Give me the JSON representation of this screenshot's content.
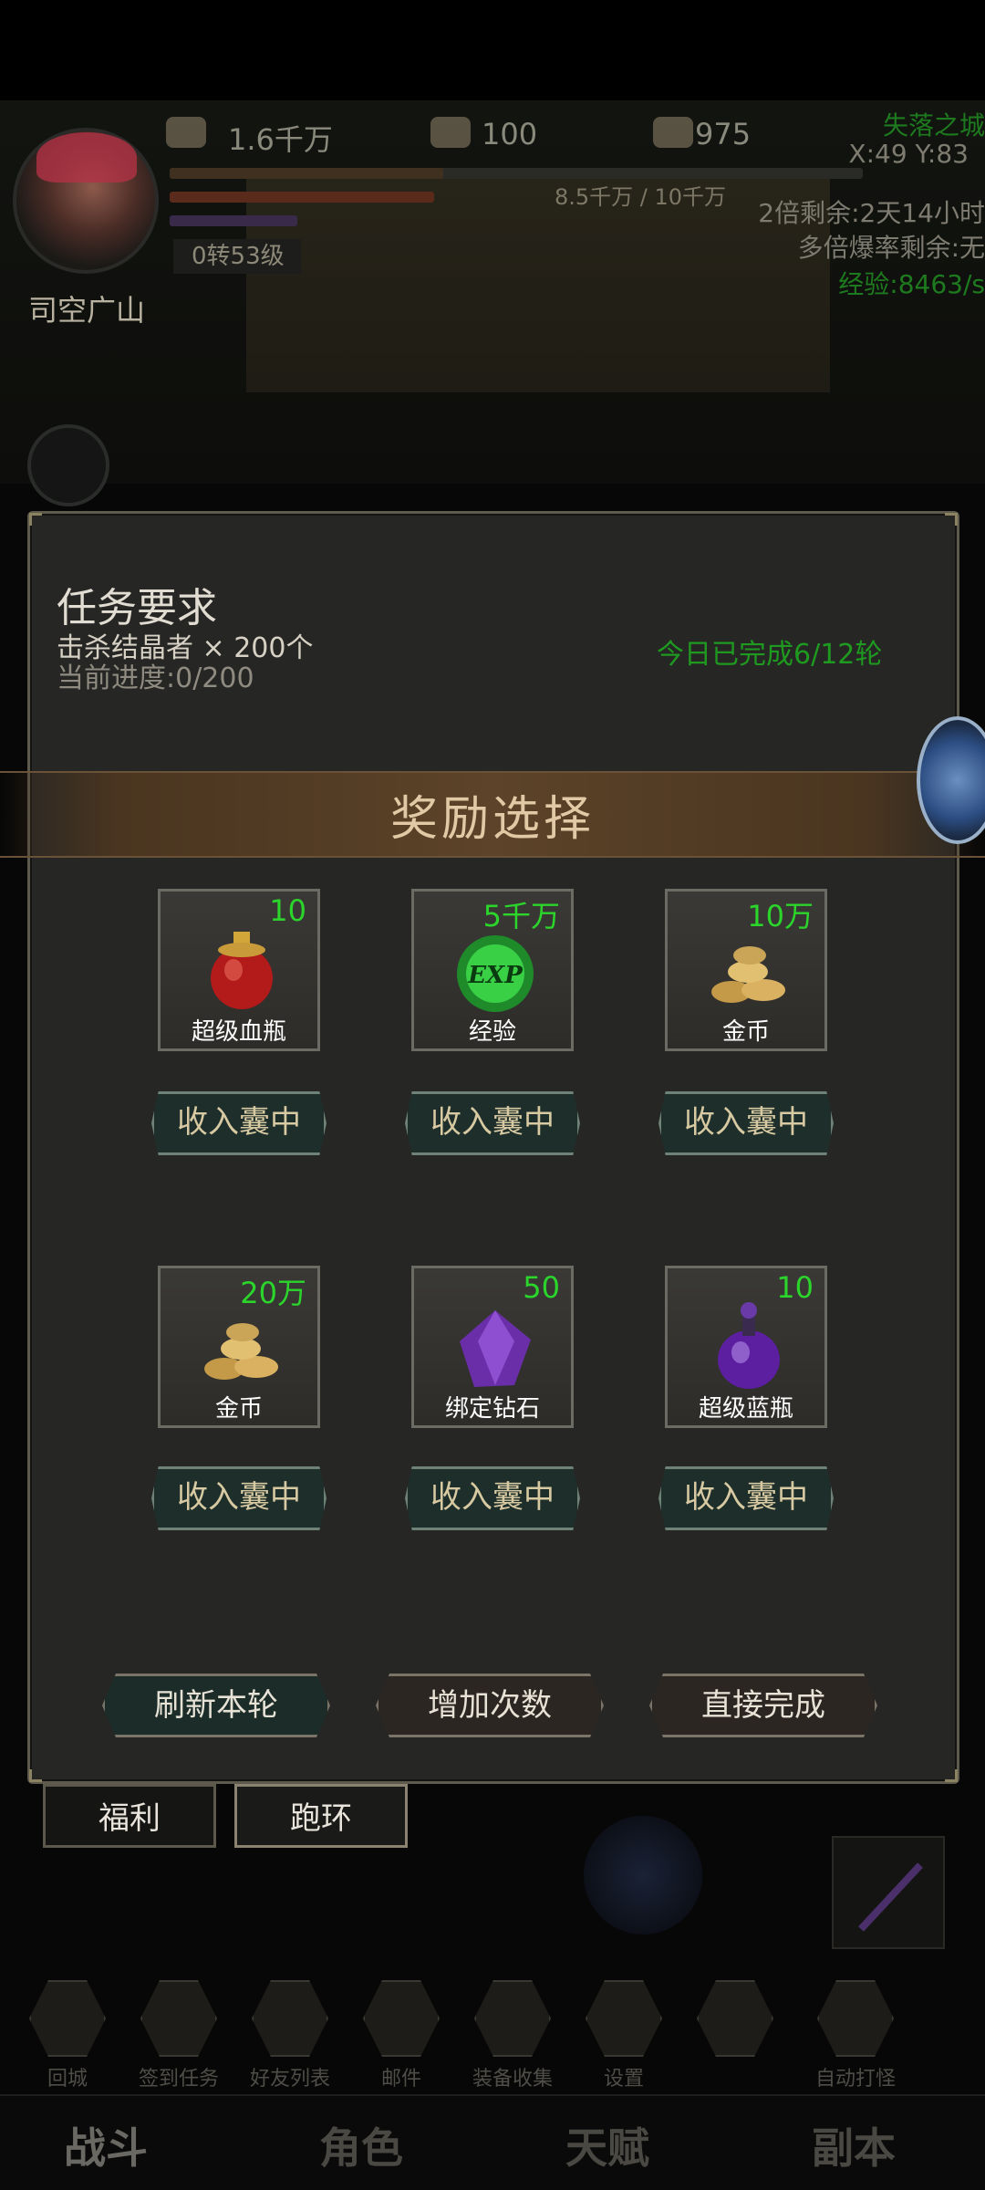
{
  "hud": {
    "player_name": "司空广山",
    "gold": "1.6千万",
    "ingot": "100",
    "chest": "975",
    "level": "0转53级",
    "hp": "8.5千万 / 10千万",
    "map_name": "失落之城",
    "coords": "X:49 Y:83",
    "double_remaining": "2倍剩余:2天14小时",
    "multi_drop": "多倍爆率剩余:无",
    "exp_rate": "经验:8463/s"
  },
  "task": {
    "title": "任务要求",
    "requirement": "击杀结晶者 × 200个",
    "progress": "当前进度:0/200",
    "today": "今日已完成6/12轮"
  },
  "reward": {
    "heading": "奖励选择",
    "store_label": "收入囊中",
    "items": [
      {
        "name": "超级血瓶",
        "count": "10",
        "icon": "red-potion-icon"
      },
      {
        "name": "经验",
        "count": "5千万",
        "icon": "exp-orb-icon"
      },
      {
        "name": "金币",
        "count": "10万",
        "icon": "gold-coins-icon"
      },
      {
        "name": "金币",
        "count": "20万",
        "icon": "gold-coins-icon"
      },
      {
        "name": "绑定钻石",
        "count": "50",
        "icon": "purple-diamond-icon"
      },
      {
        "name": "超级蓝瓶",
        "count": "10",
        "icon": "purple-potion-icon"
      }
    ]
  },
  "actions": {
    "refresh": "刷新本轮",
    "add_times": "增加次数",
    "complete": "直接完成"
  },
  "tabs": {
    "welfare": "福利",
    "loop": "跑环"
  },
  "nav": [
    "回城",
    "签到任务",
    "好友列表",
    "邮件",
    "装备收集",
    "设置",
    "",
    "自动打怪"
  ],
  "bottom_tabs": [
    "战斗",
    "角色",
    "天赋",
    "副本"
  ],
  "colors": {
    "count_green": "#2bd52b",
    "today_green": "#1f9a20",
    "panel_bg": "#262624",
    "store_gold": "#d7c9a1"
  }
}
